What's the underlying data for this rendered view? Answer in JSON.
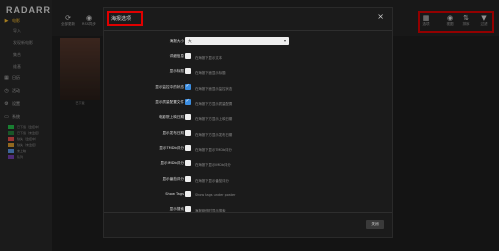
{
  "app": {
    "logo": "RADARR"
  },
  "sidebar": {
    "items": [
      {
        "label": "电影",
        "icon": "film-icon",
        "active": true
      },
      {
        "label": "日历",
        "icon": "calendar-icon"
      },
      {
        "label": "活动",
        "icon": "clock-icon"
      },
      {
        "label": "设置",
        "icon": "gear-icon"
      },
      {
        "label": "系统",
        "icon": "monitor-icon"
      }
    ],
    "subitems": [
      "导入",
      "发现新电影",
      "集合",
      "维基"
    ],
    "status_legend": [
      "已下载（监控中）",
      "已下载（未监控）",
      "缺失（监控中）",
      "缺失（未监控）",
      "未上映",
      "队列"
    ],
    "status_colors": [
      "#27c24c",
      "#27c24c",
      "#f05050",
      "#e0a030",
      "#5d9cec",
      "#7a43b6"
    ]
  },
  "topbar": {
    "left_buttons": [
      {
        "label": "全部更新",
        "icon": "refresh-icon"
      },
      {
        "label": "RSS同步",
        "icon": "rss-icon"
      }
    ],
    "right_buttons": [
      {
        "label": "选项",
        "icon": "grid-icon"
      },
      {
        "label": "视图",
        "icon": "eye-icon"
      },
      {
        "label": "排序",
        "icon": "sort-icon"
      },
      {
        "label": "过滤",
        "icon": "filter-icon"
      }
    ]
  },
  "poster": {
    "caption": "已下载"
  },
  "modal": {
    "title": "海报选项",
    "close_label": "×",
    "size_row": {
      "label": "海报大小",
      "value": "大"
    },
    "rows": [
      {
        "label": "详细信息",
        "checked": false,
        "help": "在海报下显示文本"
      },
      {
        "label": "显示标题",
        "checked": false,
        "help": "在海报下面显示标题"
      },
      {
        "label": "显示监控中的状态",
        "checked": true,
        "help": "在海报下面显示监控状态"
      },
      {
        "label": "显示质量配置文件",
        "checked": true,
        "help": "在海报下方显示质量配置"
      },
      {
        "label": "电影院上映日期",
        "checked": false,
        "help": "在海报下方显示上映日期"
      },
      {
        "label": "显示发布日期",
        "checked": false,
        "help": "在海报下方显示发布日期"
      },
      {
        "label": "显示TMDb评分",
        "checked": false,
        "help": "在海报下显示TMDb评分"
      },
      {
        "label": "显示IMDb评分",
        "checked": false,
        "help": "在海报下显示IMDb评分"
      },
      {
        "label": "显示番茄评分",
        "checked": false,
        "help": "在海报下显示番茄评分"
      },
      {
        "label": "Show Tags",
        "checked": false,
        "help": "Show tags under poster"
      },
      {
        "label": "显示搜索",
        "checked": false,
        "help": "海报悬停时显示搜索"
      }
    ],
    "ok_label": "关闭"
  }
}
